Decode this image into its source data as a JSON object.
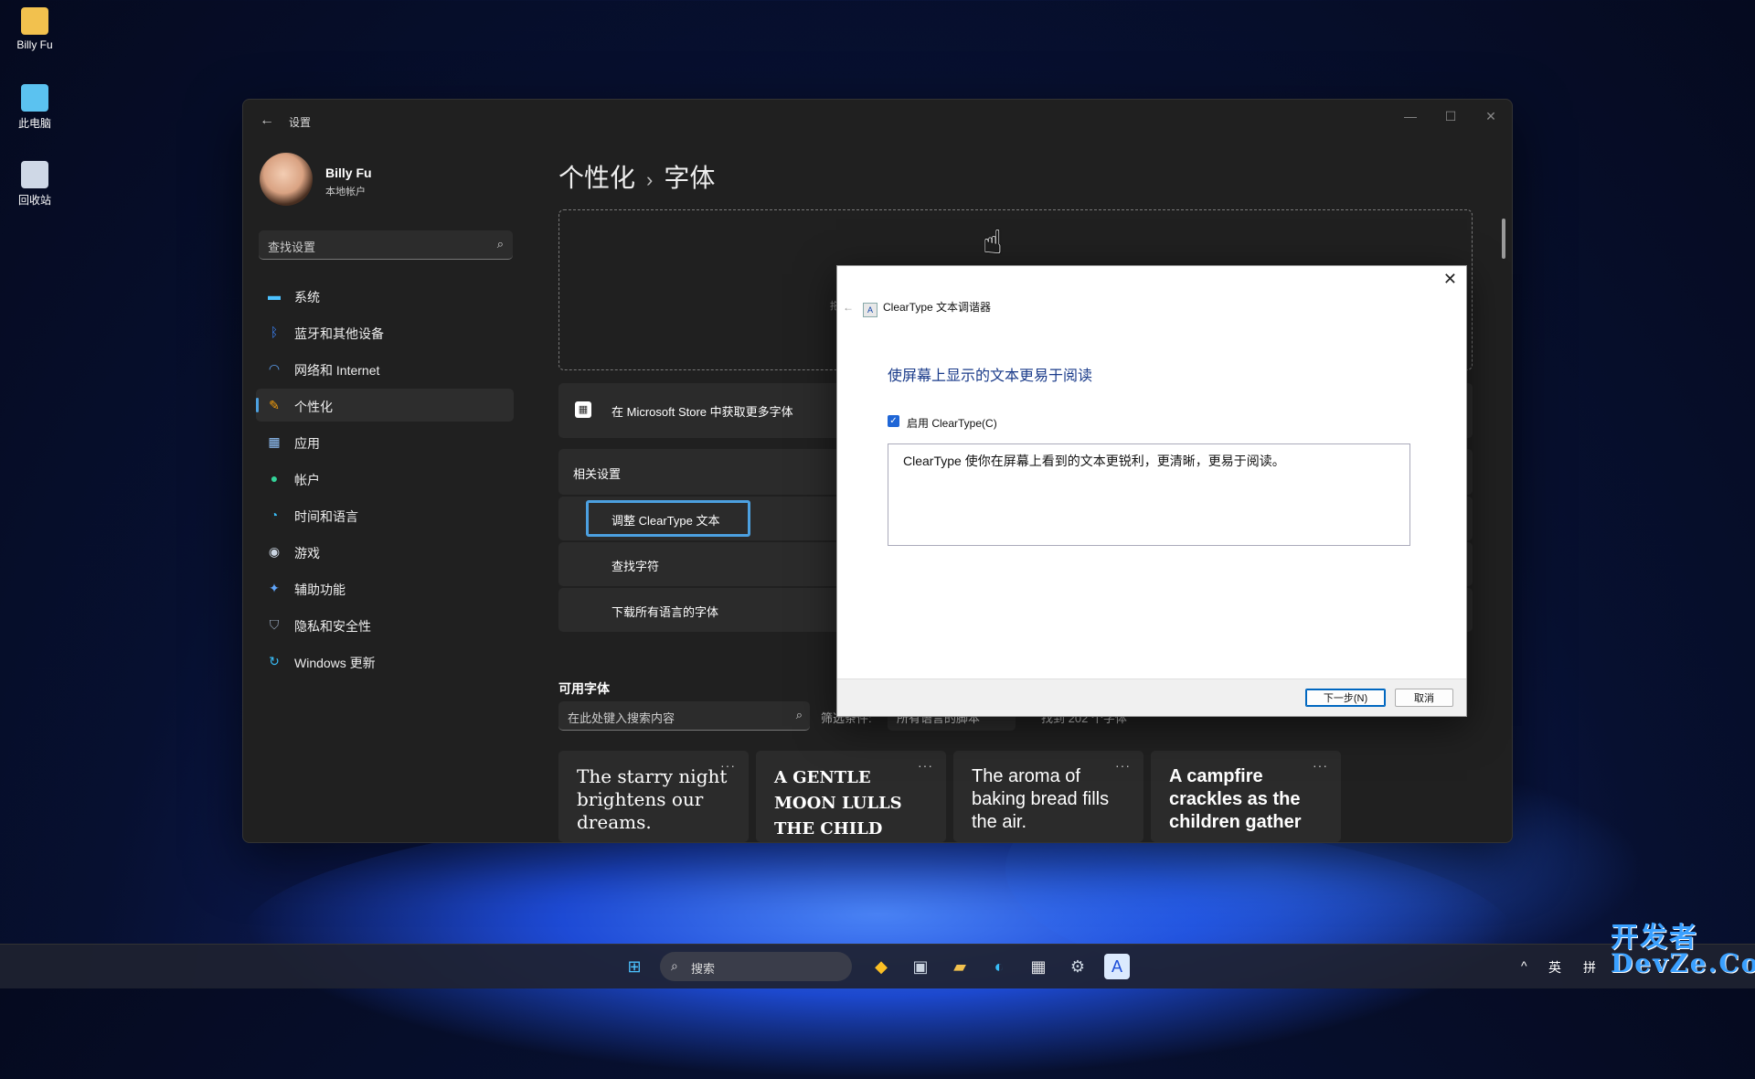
{
  "desktop": {
    "icons": [
      {
        "label": "Billy Fu",
        "icon": "folder-icon",
        "color": "#f2c14e"
      },
      {
        "label": "此电脑",
        "icon": "computer-icon",
        "color": "#5bc2f0"
      },
      {
        "label": "回收站",
        "icon": "recycle-bin-icon",
        "color": "#cfd8e6"
      }
    ]
  },
  "settings": {
    "window_title": "设置",
    "back_glyph": "←",
    "controls": {
      "minimize": "—",
      "maximize": "☐",
      "close": "✕"
    },
    "user": {
      "name": "Billy Fu",
      "account_type": "本地帐户"
    },
    "search_placeholder": "查找设置",
    "nav": [
      {
        "label": "系统",
        "icon": "system-icon",
        "glyph": "▬",
        "color": "#4cc2ff"
      },
      {
        "label": "蓝牙和其他设备",
        "icon": "bluetooth-icon",
        "glyph": "ᛒ",
        "color": "#3b82f6"
      },
      {
        "label": "网络和 Internet",
        "icon": "wifi-icon",
        "glyph": "◠",
        "color": "#60a5fa"
      },
      {
        "label": "个性化",
        "icon": "brush-icon",
        "glyph": "✎",
        "color": "#f59e0b"
      },
      {
        "label": "应用",
        "icon": "apps-icon",
        "glyph": "▦",
        "color": "#93c5fd"
      },
      {
        "label": "帐户",
        "icon": "account-icon",
        "glyph": "●",
        "color": "#34d399"
      },
      {
        "label": "时间和语言",
        "icon": "globe-clock-icon",
        "glyph": "◔",
        "color": "#38bdf8"
      },
      {
        "label": "游戏",
        "icon": "gamepad-icon",
        "glyph": "◉",
        "color": "#cbd5e1"
      },
      {
        "label": "辅助功能",
        "icon": "accessibility-icon",
        "glyph": "✦",
        "color": "#60a5fa"
      },
      {
        "label": "隐私和安全性",
        "icon": "shield-icon",
        "glyph": "⛉",
        "color": "#94a3b8"
      },
      {
        "label": "Windows 更新",
        "icon": "update-icon",
        "glyph": "↻",
        "color": "#38bdf8"
      }
    ],
    "active_nav": "个性化",
    "breadcrumb": {
      "parent": "个性化",
      "sep": "›",
      "current": "字体"
    },
    "dropzone_hint": "拖",
    "store_link": "在 Microsoft Store 中获取更多字体",
    "related_header": "相关设置",
    "related_items": [
      "调整 ClearType 文本",
      "查找字符",
      "下载所有语言的字体"
    ],
    "available_header": "可用字体",
    "font_search_placeholder": "在此处键入搜索内容",
    "filter_label": "筛选条件:",
    "filter_value": "所有语言的脚本",
    "found_text": "找到 202 个字体",
    "more_glyph": "···",
    "font_cards": [
      "The starry night brightens our dreams.",
      "A GENTLE MOON LULLS THE CHILD TO...",
      "The aroma of baking bread fills the air.",
      "A campfire crackles as the children gather"
    ]
  },
  "dialog": {
    "app_title": "ClearType 文本调谐器",
    "close_glyph": "✕",
    "heading": "使屏幕上显示的文本更易于阅读",
    "checkbox_label": "启用 ClearType(C)",
    "checkbox_checked": true,
    "sample_text": "ClearType 使你在屏幕上看到的文本更锐利，更清晰，更易于阅读。",
    "next_button": "下一步(N)",
    "cancel_button": "取消"
  },
  "taskbar": {
    "search_placeholder": "搜索",
    "tray": {
      "chevron": "^",
      "lang": "英",
      "ime": "拼"
    }
  },
  "watermark": {
    "line1": "开发者",
    "line2": "DevZe.CoM"
  },
  "colors": {
    "accent": "#4ca0e0",
    "dialog_heading": "#1a3b8a"
  }
}
